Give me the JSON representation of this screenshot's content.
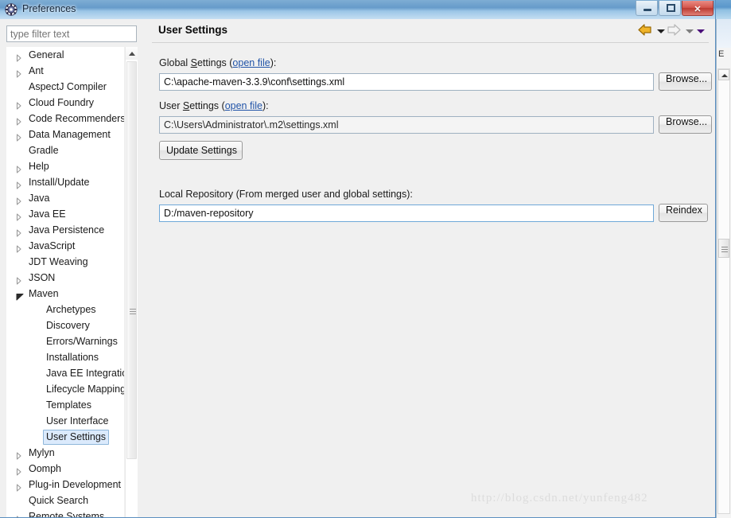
{
  "window": {
    "title": "Preferences",
    "icon": "gear-icon",
    "controls": {
      "minimize": "Minimize",
      "restore": "Restore",
      "close": "Close",
      "close_glyph": "✕"
    }
  },
  "filter": {
    "placeholder": "type filter text",
    "value": ""
  },
  "tree": {
    "items": [
      {
        "label": "General",
        "level": 1,
        "state": "collapsed",
        "selected": false
      },
      {
        "label": "Ant",
        "level": 1,
        "state": "collapsed",
        "selected": false
      },
      {
        "label": "AspectJ Compiler",
        "level": 1,
        "state": "leaf",
        "selected": false
      },
      {
        "label": "Cloud Foundry",
        "level": 1,
        "state": "collapsed",
        "selected": false
      },
      {
        "label": "Code Recommenders",
        "level": 1,
        "state": "collapsed",
        "selected": false
      },
      {
        "label": "Data Management",
        "level": 1,
        "state": "collapsed",
        "selected": false
      },
      {
        "label": "Gradle",
        "level": 1,
        "state": "leaf",
        "selected": false
      },
      {
        "label": "Help",
        "level": 1,
        "state": "collapsed",
        "selected": false
      },
      {
        "label": "Install/Update",
        "level": 1,
        "state": "collapsed",
        "selected": false
      },
      {
        "label": "Java",
        "level": 1,
        "state": "collapsed",
        "selected": false
      },
      {
        "label": "Java EE",
        "level": 1,
        "state": "collapsed",
        "selected": false
      },
      {
        "label": "Java Persistence",
        "level": 1,
        "state": "collapsed",
        "selected": false
      },
      {
        "label": "JavaScript",
        "level": 1,
        "state": "collapsed",
        "selected": false
      },
      {
        "label": "JDT Weaving",
        "level": 1,
        "state": "leaf",
        "selected": false
      },
      {
        "label": "JSON",
        "level": 1,
        "state": "collapsed",
        "selected": false
      },
      {
        "label": "Maven",
        "level": 1,
        "state": "expanded",
        "selected": false
      },
      {
        "label": "Archetypes",
        "level": 2,
        "state": "leaf",
        "selected": false
      },
      {
        "label": "Discovery",
        "level": 2,
        "state": "leaf",
        "selected": false
      },
      {
        "label": "Errors/Warnings",
        "level": 2,
        "state": "leaf",
        "selected": false
      },
      {
        "label": "Installations",
        "level": 2,
        "state": "leaf",
        "selected": false
      },
      {
        "label": "Java EE Integration",
        "level": 2,
        "state": "leaf",
        "selected": false
      },
      {
        "label": "Lifecycle Mappings",
        "level": 2,
        "state": "leaf",
        "selected": false
      },
      {
        "label": "Templates",
        "level": 2,
        "state": "leaf",
        "selected": false
      },
      {
        "label": "User Interface",
        "level": 2,
        "state": "leaf",
        "selected": false
      },
      {
        "label": "User Settings",
        "level": 2,
        "state": "leaf",
        "selected": true
      },
      {
        "label": "Mylyn",
        "level": 1,
        "state": "collapsed",
        "selected": false
      },
      {
        "label": "Oomph",
        "level": 1,
        "state": "collapsed",
        "selected": false
      },
      {
        "label": "Plug-in Development",
        "level": 1,
        "state": "collapsed",
        "selected": false
      },
      {
        "label": "Quick Search",
        "level": 1,
        "state": "leaf",
        "selected": false
      },
      {
        "label": "Remote Systems",
        "level": 1,
        "state": "collapsed",
        "selected": false
      }
    ]
  },
  "content": {
    "page_title": "User Settings",
    "nav": {
      "back_icon": "back-arrow-icon",
      "back_menu_icon": "chevron-down-icon",
      "forward_icon": "forward-arrow-icon",
      "forward_menu_icon": "chevron-down-icon",
      "view_menu_icon": "chevron-down-icon"
    },
    "global_settings": {
      "label_prefix": "Global ",
      "label_mnemonic": "S",
      "label_rest": "ettings (",
      "link": "open file",
      "label_suffix": "):",
      "value": "C:\\apache-maven-3.3.9\\conf\\settings.xml",
      "browse_label": "Browse..."
    },
    "user_settings": {
      "label_prefix": "User ",
      "label_mnemonic": "S",
      "label_rest": "ettings (",
      "link": "open file",
      "label_suffix": "):",
      "value": "C:\\Users\\Administrator\\.m2\\settings.xml",
      "browse_label": "Browse..."
    },
    "update_settings_label": "Update Settings",
    "local_repository": {
      "label": "Local Repository (From merged user and global settings):",
      "value": "D:/maven-repository",
      "reindex_label": "Reindex"
    }
  },
  "watermark": "http://blog.csdn.net/yunfeng482",
  "colors": {
    "link": "#2154a8",
    "selection_fill": "#dbeafc",
    "selection_border": "#8fb7da",
    "close_button": "#bb3a31",
    "back_arrow": "#e8a317",
    "dialog_bg": "#f0f0f0"
  }
}
